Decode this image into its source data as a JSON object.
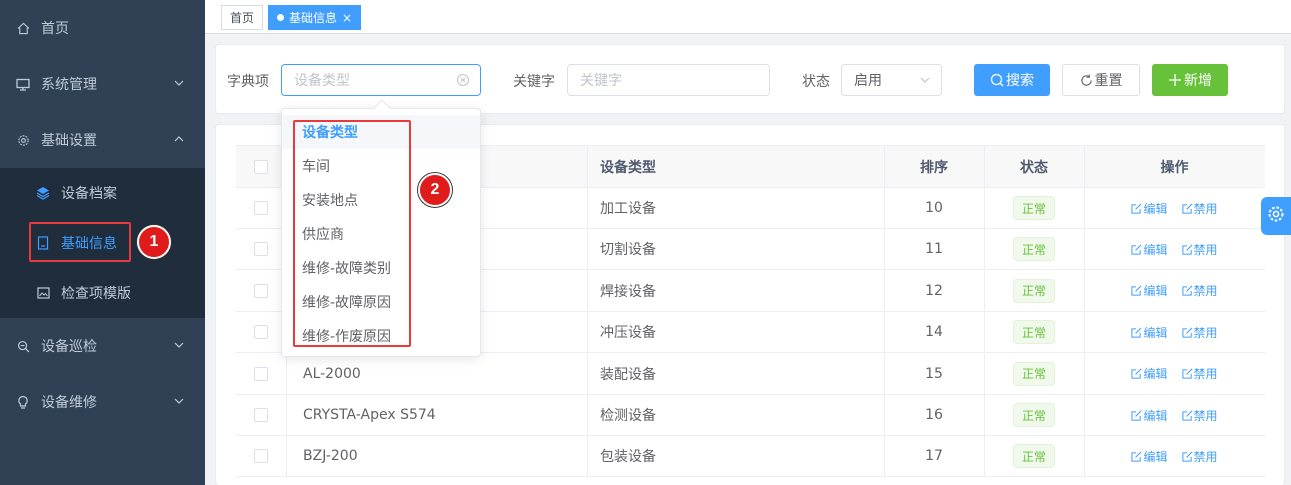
{
  "sidebar": {
    "items": [
      {
        "label": "首页",
        "icon": "home-icon"
      },
      {
        "label": "系统管理",
        "icon": "monitor-icon"
      },
      {
        "label": "基础设置",
        "icon": "gear-icon"
      },
      {
        "label": "设备巡检",
        "icon": "zoom-icon"
      },
      {
        "label": "设备维修",
        "icon": "bulb-icon"
      }
    ],
    "subitems": [
      {
        "label": "设备档案",
        "icon": "layers-icon"
      },
      {
        "label": "基础信息",
        "icon": "document-icon"
      },
      {
        "label": "检查项模版",
        "icon": "picture-icon"
      }
    ]
  },
  "annotations": {
    "badge1": "1",
    "badge2": "2"
  },
  "tags": {
    "home": "首页",
    "active": "基础信息",
    "close": "×"
  },
  "search": {
    "dict_label": "字典项",
    "dict_placeholder": "设备类型",
    "keyword_label": "关键字",
    "keyword_placeholder": "关键字",
    "status_label": "状态",
    "status_value": "启用",
    "search_btn": "搜索",
    "reset_btn": "重置",
    "add_btn": "新增"
  },
  "dropdown": {
    "options": [
      "设备类型",
      "车间",
      "安装地点",
      "供应商",
      "维修-故障类别",
      "维修-故障原因",
      "维修-作废原因"
    ],
    "selected_index": 0
  },
  "table": {
    "headers": {
      "type": "设备类型",
      "sort": "排序",
      "status": "状态",
      "ops": "操作"
    },
    "rows": [
      {
        "name": "",
        "type": "加工设备",
        "sort": "10",
        "status": "正常"
      },
      {
        "name": "",
        "type": "切割设备",
        "sort": "11",
        "status": "正常"
      },
      {
        "name": "",
        "type": "焊接设备",
        "sort": "12",
        "status": "正常"
      },
      {
        "name": "",
        "type": "冲压设备",
        "sort": "14",
        "status": "正常"
      },
      {
        "name": "AL-2000",
        "type": "装配设备",
        "sort": "15",
        "status": "正常"
      },
      {
        "name": "CRYSTA-Apex S574",
        "type": "检测设备",
        "sort": "16",
        "status": "正常"
      },
      {
        "name": "BZJ-200",
        "type": "包装设备",
        "sort": "17",
        "status": "正常"
      }
    ],
    "edit": "编辑",
    "disable": "禁用"
  },
  "colors": {
    "primary": "#409eff",
    "success": "#67c23a",
    "sidebar": "#304156",
    "annotation": "#e01b1b"
  }
}
